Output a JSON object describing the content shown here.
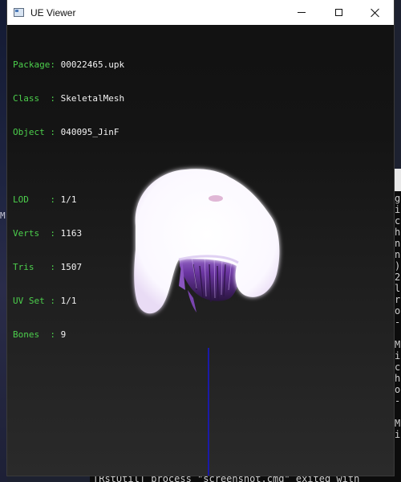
{
  "window": {
    "title": "UE Viewer",
    "app_icon": "window-app-icon",
    "controls": [
      "minimize-icon",
      "maximize-icon",
      "close-icon"
    ]
  },
  "info": {
    "package": {
      "key": "Package:",
      "value": "00022465.upk"
    },
    "class": {
      "key": "Class  :",
      "value": "SkeletalMesh"
    },
    "object": {
      "key": "Object :",
      "value": "040095_JinF"
    },
    "lod": {
      "key": "LOD    :",
      "value": "1/1"
    },
    "verts": {
      "key": "Verts  :",
      "value": "1163"
    },
    "tris": {
      "key": "Tris   :",
      "value": "1507"
    },
    "uvset": {
      "key": "UV Set :",
      "value": "1/1"
    },
    "bones": {
      "key": "Bones  :",
      "value": "9"
    }
  },
  "colors": {
    "label": "#4ccf4c",
    "value": "#f2f2f2",
    "axis": "#1a1aa8",
    "hair": "#7a3fb0"
  },
  "background": {
    "left_glyph": "M",
    "console_lines": "g\ni\nc\nh\nn\nn\n)\n2\nl\nr\no\n-\n\nM\ni\nc\nh\no\n-\n\nM\ni",
    "console_bottom": "[RstUtil] process \"screenshot.cmd\" exited with"
  }
}
